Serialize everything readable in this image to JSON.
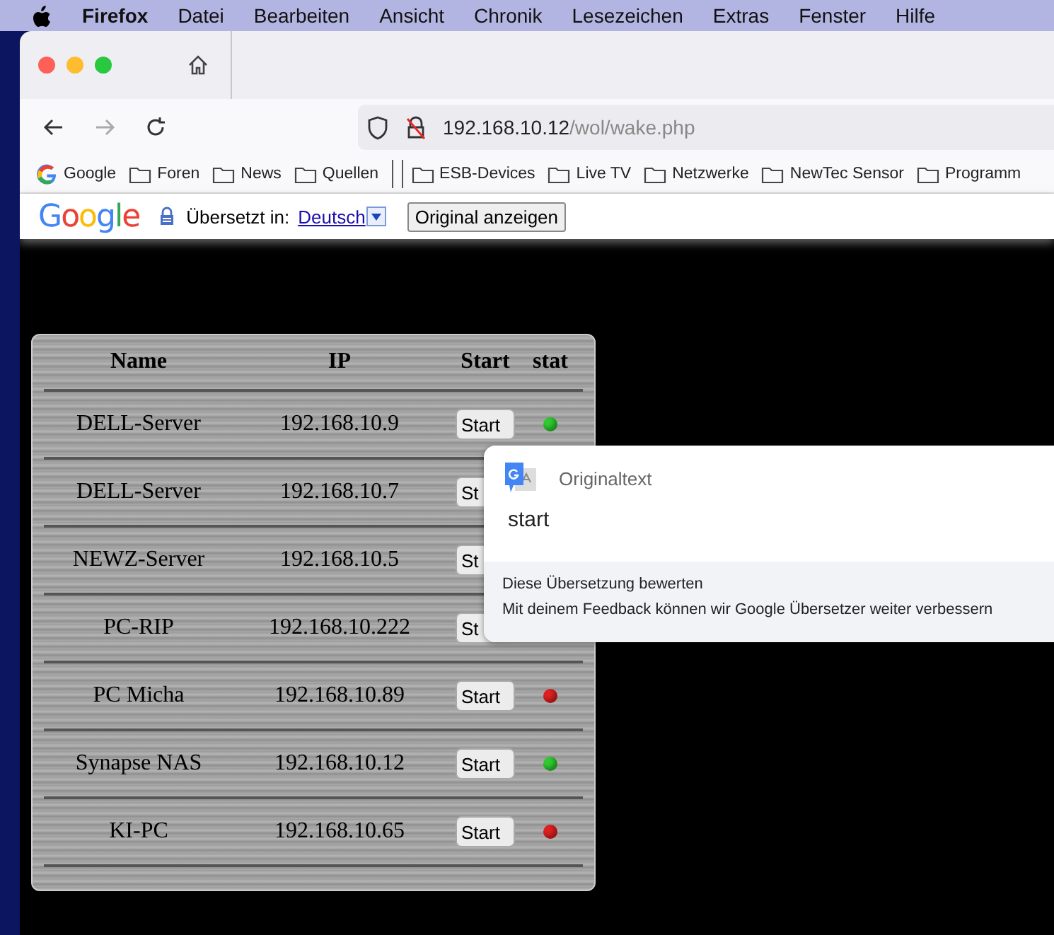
{
  "menu_bar": {
    "items": [
      {
        "label": "Firefox",
        "kind": "app"
      },
      {
        "label": "Datei",
        "kind": "menu"
      },
      {
        "label": "Bearbeiten",
        "kind": "menu"
      },
      {
        "label": "Ansicht",
        "kind": "menu"
      },
      {
        "label": "Chronik",
        "kind": "menu"
      },
      {
        "label": "Lesezeichen",
        "kind": "menu"
      },
      {
        "label": "Extras",
        "kind": "menu"
      },
      {
        "label": "Fenster",
        "kind": "menu"
      },
      {
        "label": "Hilfe",
        "kind": "menu"
      }
    ]
  },
  "address_bar": {
    "host": "192.168.10.12",
    "path": "/wol/wake.php"
  },
  "bookmarks": [
    {
      "label": "Google",
      "kind": "site"
    },
    {
      "label": "Foren",
      "kind": "folder"
    },
    {
      "label": "News",
      "kind": "folder"
    },
    {
      "label": "Quellen",
      "kind": "folder"
    },
    {
      "kind": "separator"
    },
    {
      "label": "ESB-Devices",
      "kind": "folder"
    },
    {
      "label": "Live TV",
      "kind": "folder"
    },
    {
      "label": "Netzwerke",
      "kind": "folder"
    },
    {
      "label": "NewTec Sensor",
      "kind": "folder"
    },
    {
      "label": "Programm",
      "kind": "folder"
    }
  ],
  "translate_bar": {
    "logo": "Google",
    "label": "Übersetzt in:",
    "language": "Deutsch",
    "button": "Original anzeigen"
  },
  "table": {
    "columns": [
      "Name",
      "IP",
      "Start",
      "stat"
    ],
    "rows": [
      {
        "name": "DELL-Server",
        "ip": "192.168.10.9",
        "button": "Start",
        "color": "#2ecc2e"
      },
      {
        "name": "DELL-Server",
        "ip": "192.168.10.7",
        "button": "St"
      },
      {
        "name": "NEWZ-Server",
        "ip": "192.168.10.5",
        "button": "St"
      },
      {
        "name": "PC-RIP",
        "ip": "192.168.10.222",
        "button": "St"
      },
      {
        "name": "PC Micha",
        "ip": "192.168.10.89",
        "button": "Start",
        "color": "#e02020"
      },
      {
        "name": "Synapse NAS",
        "ip": "192.168.10.12",
        "button": "Start",
        "color": "#2ecc2e"
      },
      {
        "name": "KI-PC",
        "ip": "192.168.10.65",
        "button": "Start",
        "color": "#e02020"
      }
    ]
  },
  "popup": {
    "title": "Originaltext",
    "text": "start",
    "rate": "Diese Übersetzung bewerten",
    "feedback": "Mit deinem Feedback können wir Google Übersetzer weiter verbessern"
  }
}
